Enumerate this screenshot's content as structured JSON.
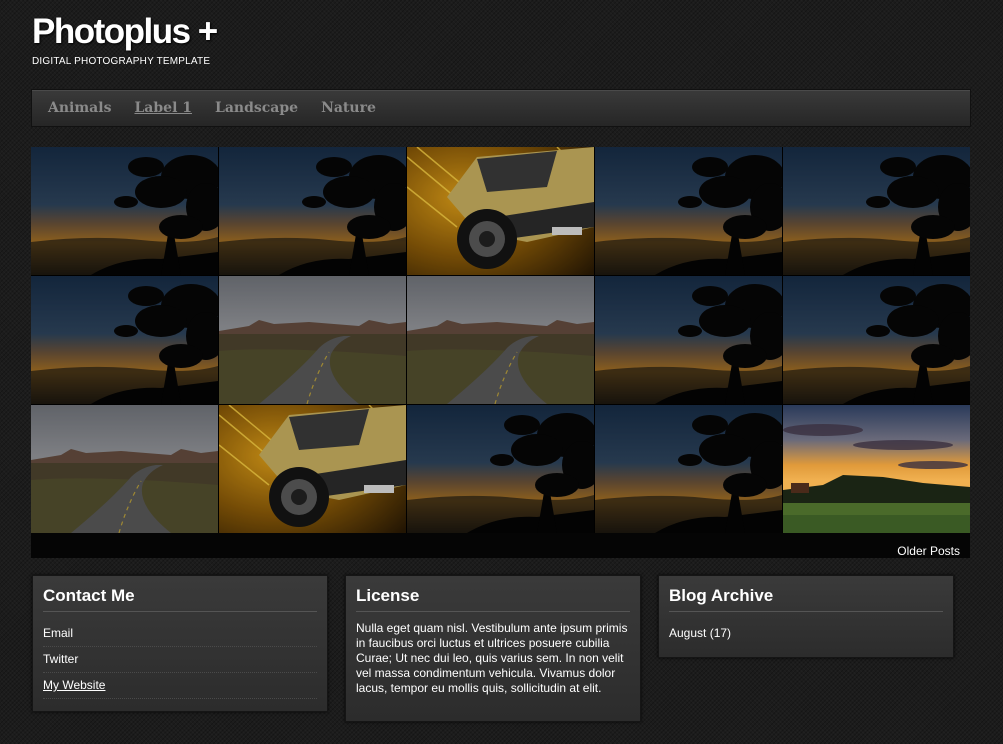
{
  "header": {
    "title": "Photoplus +",
    "description": "DIGITAL PHOTOGRAPHY TEMPLATE"
  },
  "nav": {
    "items": [
      {
        "label": "Animals",
        "active": false
      },
      {
        "label": "Label 1",
        "active": true
      },
      {
        "label": "Landscape",
        "active": false
      },
      {
        "label": "Nature",
        "active": false
      }
    ]
  },
  "gallery": {
    "rows": [
      [
        "tree-sunset",
        "tree-sunset",
        "yellow-truck",
        "tree-sunset",
        "tree-sunset"
      ],
      [
        "tree-sunset",
        "desert-road",
        "desert-road",
        "tree-sunset",
        "tree-sunset"
      ],
      [
        "desert-road",
        "yellow-truck",
        "tree-sunset",
        "tree-sunset",
        "meadow-sunset"
      ]
    ]
  },
  "pager": {
    "older_posts": "Older Posts"
  },
  "widgets": {
    "contact": {
      "title": "Contact Me",
      "links": [
        "Email",
        "Twitter",
        "My Website"
      ]
    },
    "license": {
      "title": "License",
      "text": "Nulla eget quam nisl. Vestibulum ante ipsum primis in faucibus orci luctus et ultrices posuere cubilia Curae; Ut nec dui leo, quis varius sem. In non velit vel massa condimentum vehicula. Vivamus dolor lacus, tempor eu mollis quis, sollicitudin at elit."
    },
    "archive": {
      "title": "Blog Archive",
      "items": [
        "August (17)"
      ]
    }
  },
  "colors": {
    "background": "#1c1c1c",
    "nav_text": "#8a8a8a",
    "widget_bg": "#333333"
  }
}
